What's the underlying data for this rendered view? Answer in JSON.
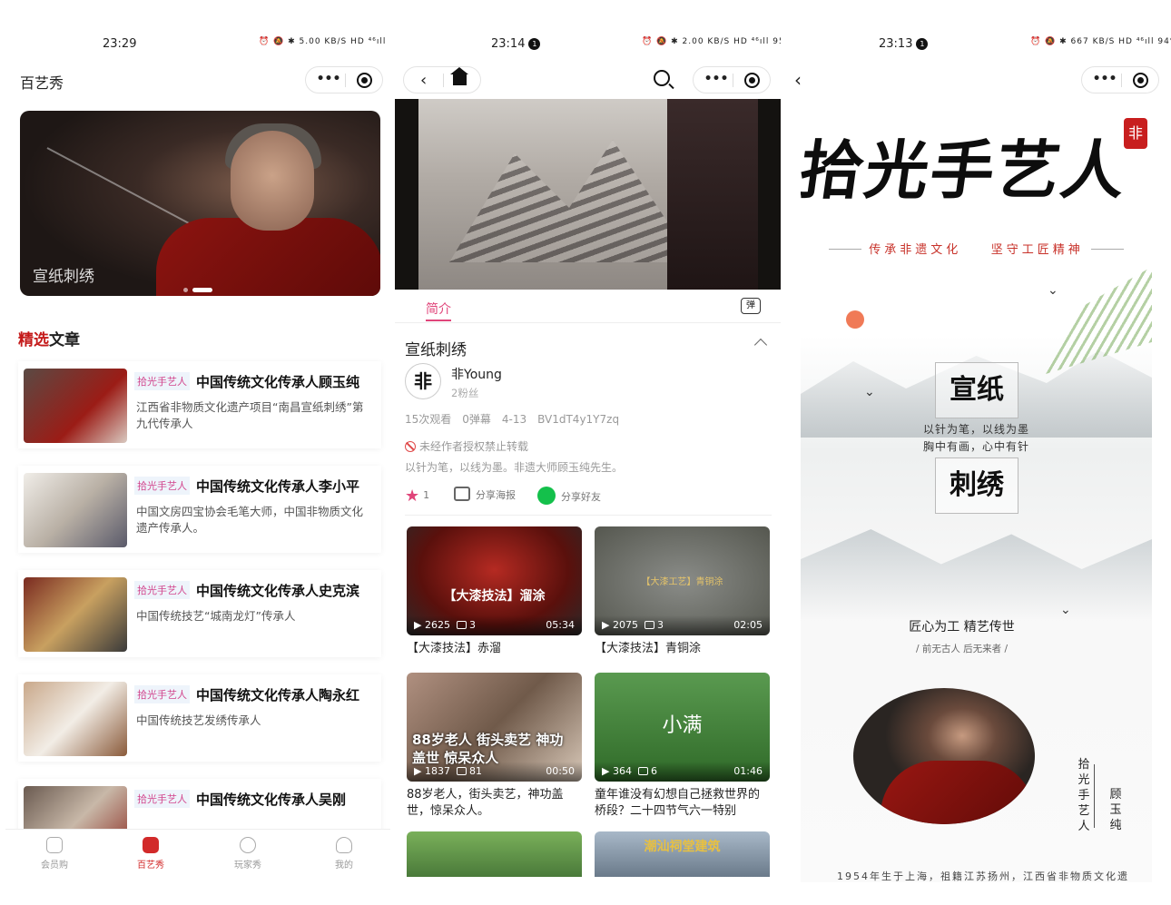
{
  "panel1": {
    "status": {
      "time": "23:29",
      "icons": "⏰ 🔕 ✱ 5.00 KB/S HD ⁴⁶ıll 100"
    },
    "title": "百艺秀",
    "banner": {
      "caption": "宣纸刺绣"
    },
    "section": {
      "accent": "精选",
      "rest": "文章"
    },
    "articles": [
      {
        "tag": "拾光手艺人",
        "title": "中国传统文化传承人顾玉纯",
        "desc": "江西省非物质文化遗产项目“南昌宣纸刺绣”第九代传承人"
      },
      {
        "tag": "拾光手艺人",
        "title": "中国传统文化传承人李小平",
        "desc": "中国文房四宝协会毛笔大师，中国非物质文化遗产传承人。"
      },
      {
        "tag": "拾光手艺人",
        "title": "中国传统文化传承人史克滨",
        "desc": "中国传统技艺“城南龙灯”传承人"
      },
      {
        "tag": "拾光手艺人",
        "title": "中国传统文化传承人陶永红",
        "desc": "中国传统技艺发绣传承人"
      },
      {
        "tag": "拾光手艺人",
        "title": "中国传统文化传承人吴刚",
        "desc": ""
      }
    ],
    "tabs": [
      "会员购",
      "百艺秀",
      "玩家秀",
      "我的"
    ]
  },
  "panel2": {
    "status": {
      "time": "23:14",
      "badge": "1",
      "icons": "⏰ 🔕 ✱ 2.00 KB/S HD ⁴⁶ıll 95%"
    },
    "tab_intro": "简介",
    "danmu": "弹",
    "video_title": "宣纸刺绣",
    "uploader": {
      "name": "非Young",
      "fans": "2粉丝",
      "avatar_char": "非"
    },
    "stats": [
      "15次观看",
      "0弹幕",
      "4-13",
      "BV1dT4y1Y7zq"
    ],
    "no_repost": "未经作者授权禁止转载",
    "description": "以针为笔，以线为墨。非遗大师顾玉纯先生。",
    "actions": {
      "likes": "1",
      "poster": "分享海报",
      "share": "分享好友"
    },
    "cards": [
      {
        "overlay": "【大漆技法】溜涂",
        "views": "2625",
        "count": "3",
        "duration": "05:34",
        "title": "【大漆技法】赤溜",
        "bg": "#8a1b17"
      },
      {
        "overlay": "【大漆工艺】青铜涂",
        "views": "2075",
        "count": "3",
        "duration": "02:05",
        "title": "【大漆技法】青铜涂",
        "bg": "#6f716d"
      },
      {
        "overlay": "88岁老人 街头卖艺 神功盖世 惊呆众人",
        "views": "1837",
        "count": "81",
        "duration": "00:50",
        "title": "88岁老人，街头卖艺，神功盖世，惊呆众人。",
        "bg": "#8f7a6a"
      },
      {
        "overlay": "小满",
        "views": "364",
        "count": "6",
        "duration": "01:46",
        "title": "童年谁没有幻想自己拯救世界的桥段？二十四节气六一特别",
        "bg": "#3e7a34"
      },
      {
        "overlay": "",
        "views": "",
        "count": "",
        "duration": "",
        "title": "",
        "bg": "#5a8a4a"
      },
      {
        "overlay": "潮汕祠堂建筑",
        "views": "",
        "count": "",
        "duration": "",
        "title": "",
        "bg": "#7a8a9a"
      }
    ]
  },
  "panel3": {
    "status": {
      "time": "23:13",
      "badge": "1",
      "icons": "⏰ 🔕 ✱ 667 KB/S HD ⁴⁶ıll 94%"
    },
    "calligraphy": "拾光手艺人",
    "seal": "非",
    "slogan_left": "传承非遗文化",
    "slogan_right": "坚守工匠精神",
    "box_top": "宣纸",
    "verse1": "以针为笔，以线为墨",
    "verse2": "胸中有画，心中有针",
    "box_bottom": "刺绣",
    "motto": "匠心为工 精艺传世",
    "motto_sub": "/ 前无古人 后无来者 /",
    "vertical_left": "拾光手艺人",
    "vertical_right": "顾玉纯",
    "bio": "1954年生于上海，祖籍江苏扬州，江西省非物质文化遗"
  }
}
